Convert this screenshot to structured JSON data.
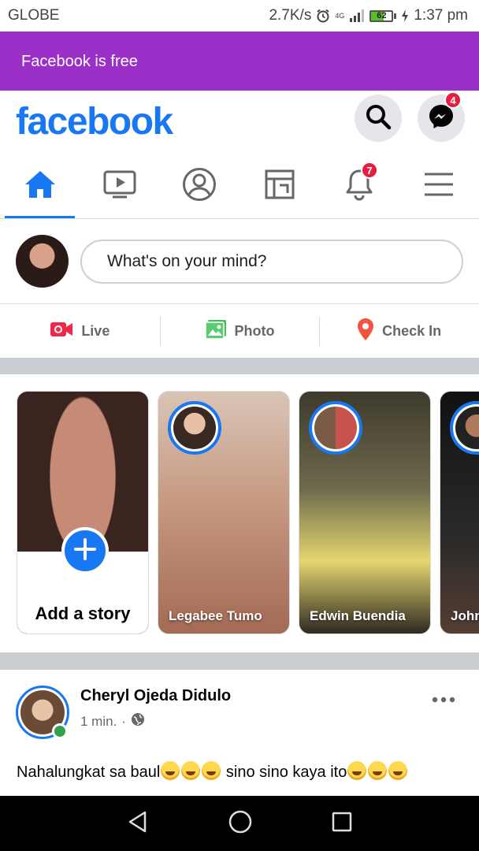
{
  "status_bar": {
    "carrier": "GLOBE",
    "speed": "2.7K/s",
    "network": "4G",
    "battery": "62",
    "time": "1:37 pm"
  },
  "banner": {
    "text": "Facebook is free",
    "color": "#9b30c8"
  },
  "header": {
    "logo": "facebook",
    "messenger_badge": "4",
    "brand_color": "#1877f2"
  },
  "tabs": {
    "notifications_badge": "7",
    "active": "home"
  },
  "composer": {
    "placeholder": "What's on your mind?"
  },
  "actions": {
    "live": "Live",
    "photo": "Photo",
    "check_in": "Check In"
  },
  "stories": {
    "add_story": "Add a story",
    "items": [
      {
        "name": "Legabee Tumo"
      },
      {
        "name": "Edwin Buendia"
      },
      {
        "name": "John"
      }
    ]
  },
  "post": {
    "author": "Cheryl Ojeda Didulo",
    "time": "1 min.",
    "separator": "·",
    "text_part1": "Nahalungkat sa baul",
    "text_part2": " sino sino kaya ito"
  }
}
